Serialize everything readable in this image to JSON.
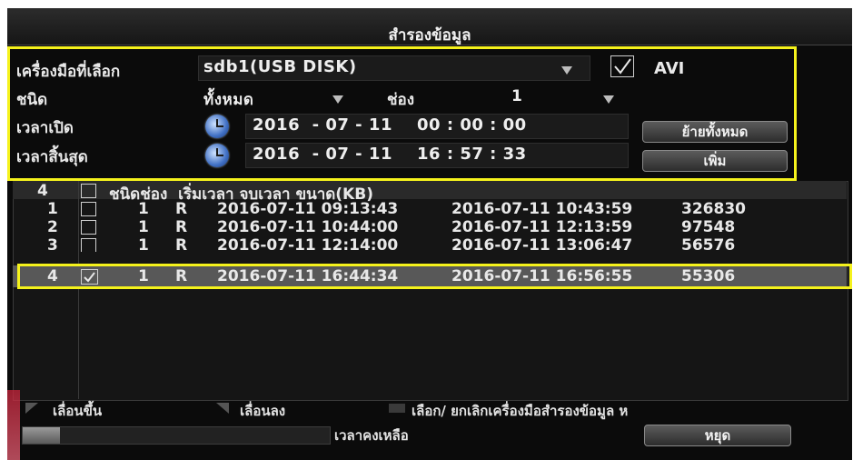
{
  "dialog": {
    "title": "สำรองข้อมูล"
  },
  "form": {
    "device_label": "เครื่องมือที่เลือก",
    "device_value": "sdb1(USB DISK)",
    "avi_label": "AVI",
    "avi_checked": true,
    "type_label": "ชนิด",
    "type_value": "ทั้งหมด",
    "channel_label": "ช่อง",
    "channel_value": "1",
    "start_label": "เวลาเปิด",
    "start_value": "2016  - 07 - 11    00 : 00 : 00",
    "end_label": "เวลาสิ้นสุด",
    "end_value": "2016  - 07 - 11    16 : 57 : 33",
    "remove_all_button": "ย้ายทั้งหมด",
    "add_button": "เพิ่ม"
  },
  "table": {
    "header": {
      "count": "4",
      "columns": "ชนิดช่อง  เริ่มเวลา จบเวลา ขนาด(KB)"
    },
    "rows": [
      {
        "idx": "1",
        "checked": false,
        "channel": "1",
        "type": "R",
        "start": "2016-07-11 09:13:43",
        "end": "2016-07-11 10:43:59",
        "size": "326830"
      },
      {
        "idx": "2",
        "checked": false,
        "channel": "1",
        "type": "R",
        "start": "2016-07-11 10:44:00",
        "end": "2016-07-11 12:13:59",
        "size": "97548"
      },
      {
        "idx": "3",
        "checked": false,
        "channel": "1",
        "type": "R",
        "start": "2016-07-11 12:14:00",
        "end": "2016-07-11 13:06:47",
        "size": "56576"
      },
      {
        "idx": "4",
        "checked": true,
        "channel": "1",
        "type": "R",
        "start": "2016-07-11 16:44:34",
        "end": "2016-07-11 16:56:55",
        "size": "55306"
      }
    ],
    "selected_row": 3
  },
  "footer": {
    "scroll_up": "เลื่อนขึ้น",
    "scroll_down": "เลื่อนลง",
    "select_hint": "เลือก/ ยกเลิกเครื่องมือสำรองข้อมูล ห",
    "remaining_label": "เวลาคงเหลือ",
    "stop_button": "หยุด",
    "progress": 0.12
  },
  "colors": {
    "highlight": "#f5f21c",
    "selected_row": "#585858"
  }
}
